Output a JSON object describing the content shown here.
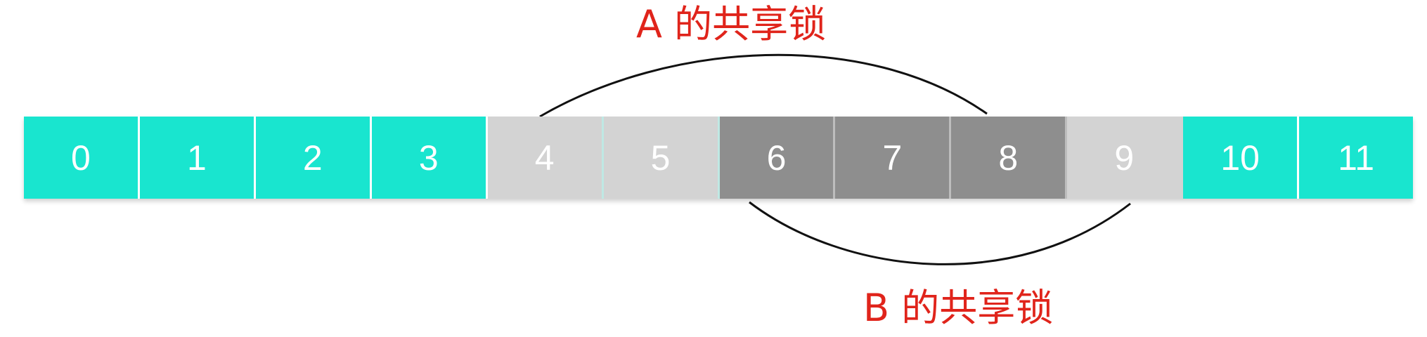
{
  "labels": {
    "a": "A 的共享锁",
    "b": "B 的共享锁"
  },
  "cells": [
    {
      "text": "0",
      "state": "free"
    },
    {
      "text": "1",
      "state": "free"
    },
    {
      "text": "2",
      "state": "free"
    },
    {
      "text": "3",
      "state": "free"
    },
    {
      "text": "4",
      "state": "shared-a"
    },
    {
      "text": "5",
      "state": "shared-a"
    },
    {
      "text": "6",
      "state": "shared-ab"
    },
    {
      "text": "7",
      "state": "shared-ab"
    },
    {
      "text": "8",
      "state": "shared-ab"
    },
    {
      "text": "9",
      "state": "shared-b"
    },
    {
      "text": "10",
      "state": "free"
    },
    {
      "text": "11",
      "state": "free"
    }
  ],
  "colors": {
    "free": "#19e5cf",
    "shared": "#d3d3d3",
    "overlap": "#8e8e8e",
    "label": "#e0241b",
    "arc": "#111111"
  }
}
